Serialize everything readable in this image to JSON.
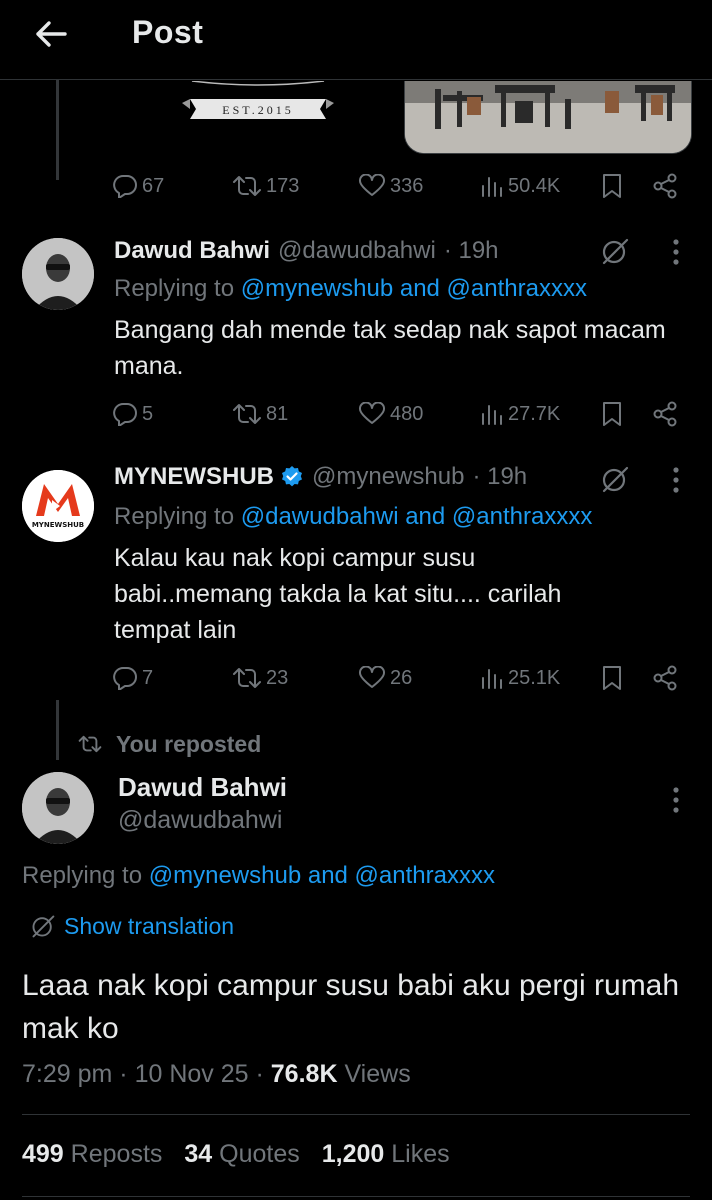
{
  "header": {
    "title": "Post"
  },
  "top_post": {
    "badge_text": "EST.2015",
    "stats": {
      "replies": "67",
      "reposts": "173",
      "likes": "336",
      "views": "50.4K"
    }
  },
  "reply1": {
    "name": "Dawud Bahwi",
    "handle": "@dawudbahwi",
    "time": "· 19h",
    "replying_prefix": "Replying to ",
    "replying_to": "@mynewshub and @anthraxxxx",
    "text": "Bangang dah mende tak sedap nak sapot macam mana.",
    "stats": {
      "replies": "5",
      "reposts": "81",
      "likes": "480",
      "views": "27.7K"
    }
  },
  "reply2": {
    "name": "MYNEWSHUB",
    "handle": "@mynewshub",
    "time": "· 19h",
    "avatar_text": "MYNEWSHUB",
    "replying_prefix": "Replying to ",
    "replying_to": "@dawudbahwi and @anthraxxxx",
    "text": "Kalau kau nak kopi campur susu babi..memang takda la kat situ.... carilah tempat lain",
    "stats": {
      "replies": "7",
      "reposts": "23",
      "likes": "26",
      "views": "25.1K"
    }
  },
  "repost_label": "You reposted",
  "main_post": {
    "name": "Dawud Bahwi",
    "handle": "@dawudbahwi",
    "replying_prefix": "Replying to ",
    "replying_to": "@mynewshub and @anthraxxxx",
    "show_translation": "Show translation",
    "text": "Laaa nak kopi campur susu babi aku pergi rumah mak ko",
    "time": "7:29 pm",
    "date": "10 Nov 25",
    "views_count": "76.8K",
    "views_label": "Views",
    "reposts_count": "499",
    "reposts_label": "Reposts",
    "quotes_count": "34",
    "quotes_label": "Quotes",
    "likes_count": "1,200",
    "likes_label": "Likes"
  },
  "colors": {
    "background": "#000000",
    "text": "#e7e9ea",
    "muted": "#71767b",
    "link": "#1d9bf0",
    "verified": "#1d9bf0",
    "divider": "#2f3336"
  }
}
